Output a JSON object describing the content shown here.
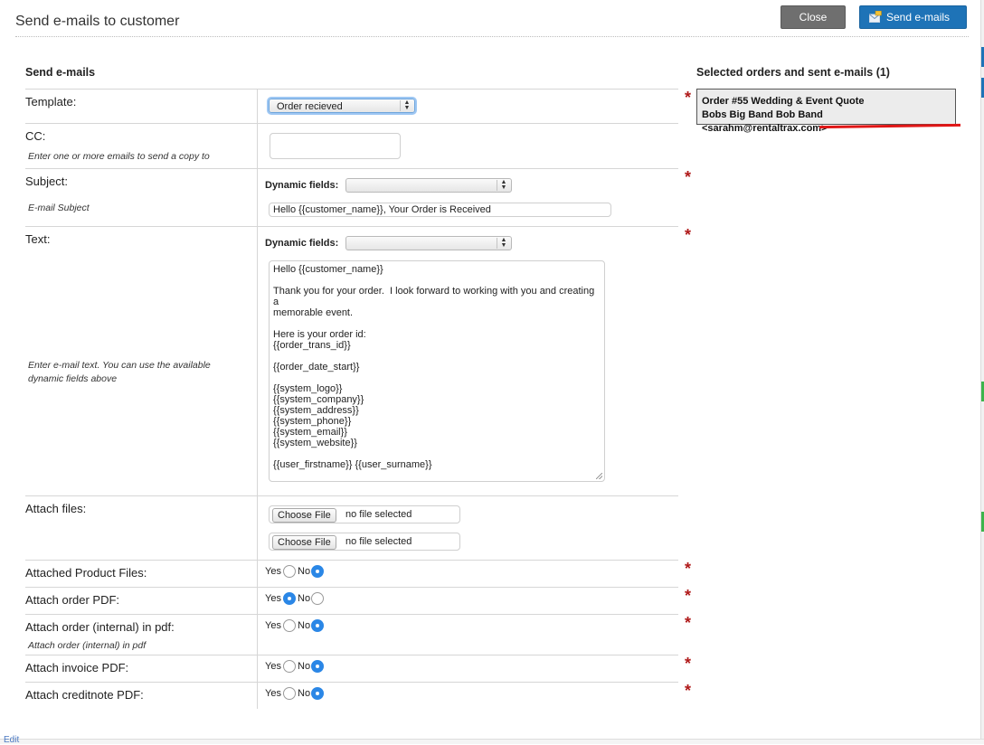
{
  "dialog": {
    "title": "Send e-mails to customer",
    "close_label": "Close",
    "send_label": "Send e-mails"
  },
  "form": {
    "heading": "Send e-mails",
    "dynamic_fields_label": "Dynamic fields:",
    "template": {
      "label": "Template:",
      "value": "Order recieved"
    },
    "cc": {
      "label": "CC:",
      "hint": "Enter one or more emails to send a copy to",
      "value": ""
    },
    "subject": {
      "label": "Subject:",
      "hint": "E-mail Subject",
      "value": "Hello {{customer_name}}, Your Order is Received"
    },
    "text": {
      "label": "Text:",
      "hint_line1": "Enter e-mail text. You can use the available",
      "hint_line2": "dynamic fields above",
      "lines": [
        "Hello {{customer_name}}",
        "",
        "Thank you for your order.  I look forward to working with you and creating a",
        "memorable event.",
        "",
        "Here is your order id:",
        "{{order_trans_id}}",
        "",
        "{{order_date_start}}",
        "",
        "{{system_logo}}",
        "{{system_company}}",
        "{{system_address}}",
        "{{system_phone}}",
        "{{system_email}}",
        "{{system_website}}",
        "",
        "{{user_firstname}} {{user_surname}}"
      ]
    },
    "attach_files": {
      "label": "Attach files:",
      "choose_label": "Choose File",
      "no_file": "no file selected"
    },
    "yes_label": "Yes",
    "no_label": "No",
    "options": [
      {
        "label": "Attached Product Files:",
        "selected": "No"
      },
      {
        "label": "Attach order PDF:",
        "selected": "Yes"
      },
      {
        "label": "Attach order (internal) in pdf:",
        "hint": "Attach order (internal) in pdf",
        "selected": "No"
      },
      {
        "label": "Attach invoice PDF:",
        "selected": "No"
      },
      {
        "label": "Attach creditnote PDF:",
        "selected": "No"
      }
    ]
  },
  "selected_orders": {
    "heading": "Selected orders and sent e-mails (1)",
    "order_line": "Order #55 Wedding & Event Quote",
    "customer_line": "Bobs Big Band Bob Band <sarahm@rentaltrax.com>"
  },
  "background": {
    "edit_link": "Edit"
  },
  "colors": {
    "primary": "#1e73b7",
    "close_button": "#6f6f6f",
    "required_star": "#b01a1a",
    "highlight_underline": "#e01616",
    "radio_selected": "#2b87e6"
  }
}
